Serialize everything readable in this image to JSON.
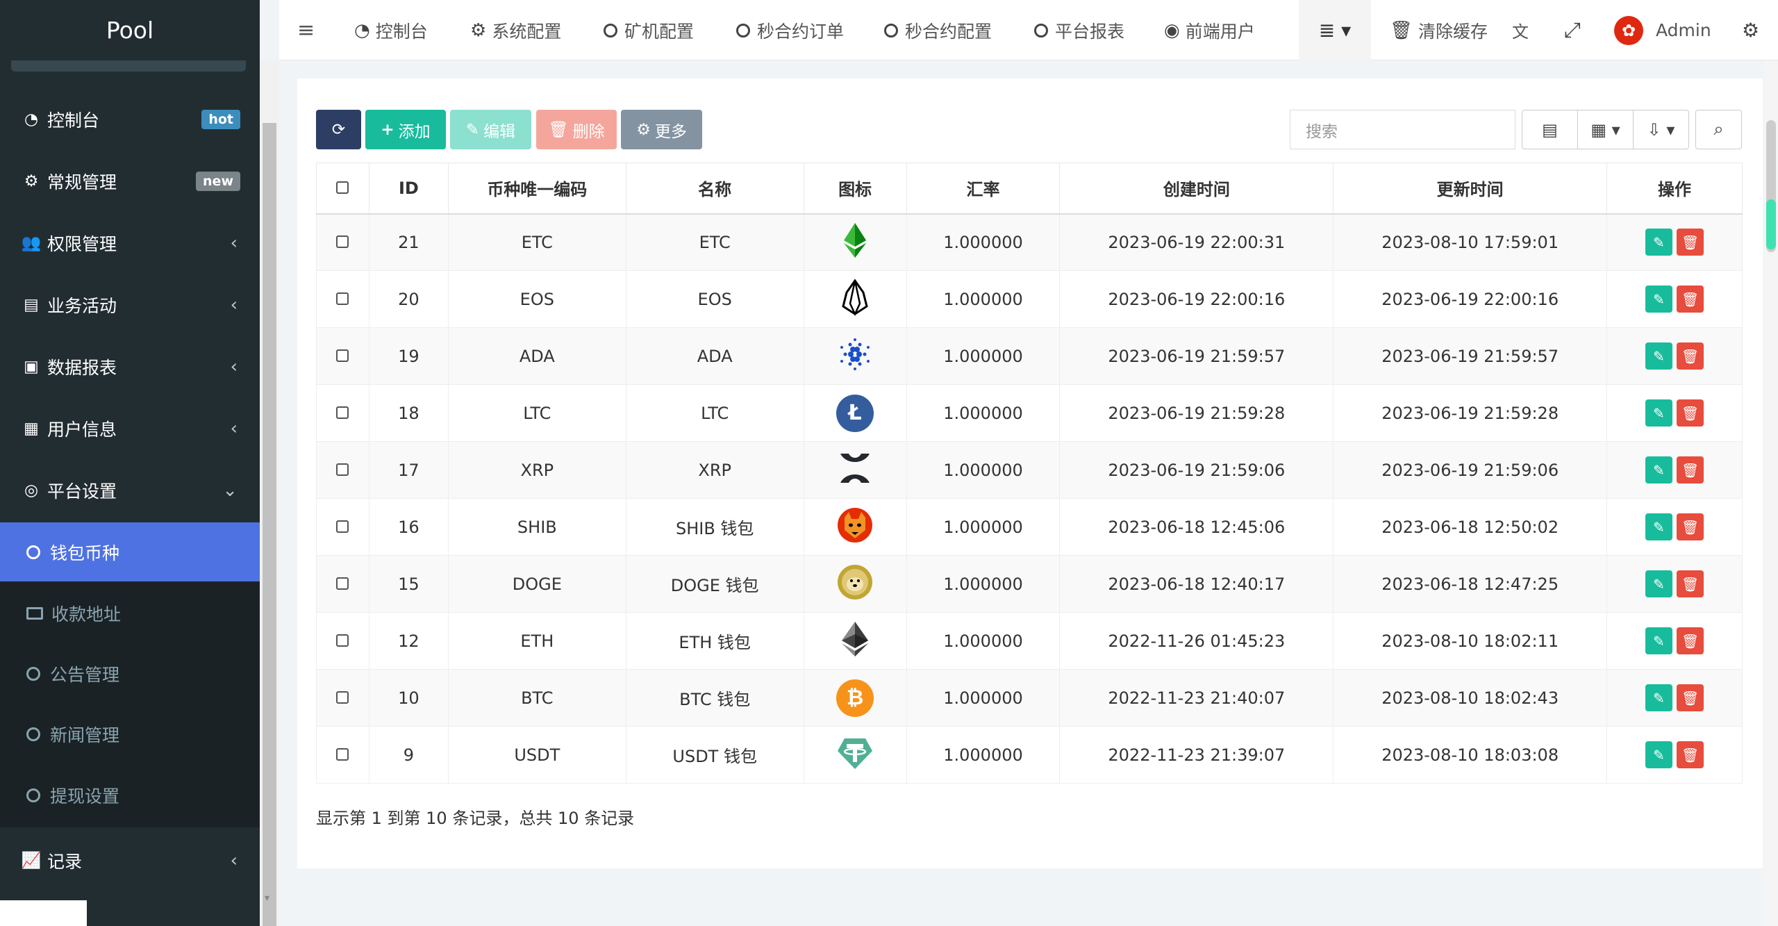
{
  "app": {
    "brand": "Pool"
  },
  "sidebar": {
    "items": [
      {
        "label": "控制台",
        "icon": "dashboard-icon",
        "glyph": "◔",
        "badge": "hot"
      },
      {
        "label": "常规管理",
        "icon": "cogs-icon",
        "glyph": "⚙",
        "badge": "new"
      },
      {
        "label": "权限管理",
        "icon": "users-icon",
        "glyph": "👥",
        "arrow": "‹"
      },
      {
        "label": "业务活动",
        "icon": "newspaper-icon",
        "glyph": "▤",
        "arrow": "‹"
      },
      {
        "label": "数据报表",
        "icon": "file-text-icon",
        "glyph": "▣",
        "arrow": "‹"
      },
      {
        "label": "用户信息",
        "icon": "user-card-icon",
        "glyph": "▦",
        "arrow": "‹"
      },
      {
        "label": "平台设置",
        "icon": "target-icon",
        "glyph": "◎",
        "arrow": "⌄"
      }
    ],
    "submenu": [
      {
        "label": "钱包币种",
        "active": true,
        "icon": "circle-icon"
      },
      {
        "label": "收款地址",
        "icon": "address-card-icon"
      },
      {
        "label": "公告管理",
        "icon": "circle-icon"
      },
      {
        "label": "新闻管理",
        "icon": "circle-icon"
      },
      {
        "label": "提现设置",
        "icon": "circle-icon"
      }
    ],
    "bottom_item": {
      "label": "记录",
      "icon": "area-chart-icon",
      "glyph": "📈",
      "arrow": "‹"
    }
  },
  "topnav": {
    "menu_toggle": "≡",
    "items": [
      {
        "label": "控制台",
        "icon": "dashboard-icon",
        "glyph": "◔"
      },
      {
        "label": "系统配置",
        "icon": "cog-icon",
        "glyph": "⚙"
      },
      {
        "label": "矿机配置",
        "icon": "circle-icon"
      },
      {
        "label": "秒合约订单",
        "icon": "circle-icon"
      },
      {
        "label": "秒合约配置",
        "icon": "circle-icon"
      },
      {
        "label": "平台报表",
        "icon": "circle-icon"
      },
      {
        "label": "前端用户",
        "icon": "user-circle-icon",
        "glyph": "◉"
      }
    ],
    "list_menu": "≣ ▾",
    "clear_cache": "清除缓存",
    "translate_glyph": "文",
    "fullscreen_glyph": "⤢",
    "user": "Admin",
    "settings_glyph": "⚙"
  },
  "toolbar": {
    "refresh": "⟳",
    "add": "添加",
    "edit": "编辑",
    "delete": "删除",
    "more": "更多",
    "search_placeholder": "搜索",
    "view_list": "▤",
    "view_columns": "▦ ▾",
    "export": "⇩ ▾",
    "search_glyph": "⌕"
  },
  "table": {
    "columns": [
      "ID",
      "币种唯一编码",
      "名称",
      "图标",
      "汇率",
      "创建时间",
      "更新时间",
      "操作"
    ],
    "rows": [
      {
        "id": "21",
        "code": "ETC",
        "name": "ETC",
        "icon": "etc-icon",
        "rate": "1.000000",
        "created": "2023-06-19 22:00:31",
        "updated": "2023-08-10 17:59:01"
      },
      {
        "id": "20",
        "code": "EOS",
        "name": "EOS",
        "icon": "eos-icon",
        "rate": "1.000000",
        "created": "2023-06-19 22:00:16",
        "updated": "2023-06-19 22:00:16"
      },
      {
        "id": "19",
        "code": "ADA",
        "name": "ADA",
        "icon": "ada-icon",
        "rate": "1.000000",
        "created": "2023-06-19 21:59:57",
        "updated": "2023-06-19 21:59:57"
      },
      {
        "id": "18",
        "code": "LTC",
        "name": "LTC",
        "icon": "ltc-icon",
        "rate": "1.000000",
        "created": "2023-06-19 21:59:28",
        "updated": "2023-06-19 21:59:28"
      },
      {
        "id": "17",
        "code": "XRP",
        "name": "XRP",
        "icon": "xrp-icon",
        "rate": "1.000000",
        "created": "2023-06-19 21:59:06",
        "updated": "2023-06-19 21:59:06"
      },
      {
        "id": "16",
        "code": "SHIB",
        "name": "SHIB 钱包",
        "icon": "shib-icon",
        "rate": "1.000000",
        "created": "2023-06-18 12:45:06",
        "updated": "2023-06-18 12:50:02"
      },
      {
        "id": "15",
        "code": "DOGE",
        "name": "DOGE 钱包",
        "icon": "doge-icon",
        "rate": "1.000000",
        "created": "2023-06-18 12:40:17",
        "updated": "2023-06-18 12:47:25"
      },
      {
        "id": "12",
        "code": "ETH",
        "name": "ETH 钱包",
        "icon": "eth-icon",
        "rate": "1.000000",
        "created": "2022-11-26 01:45:23",
        "updated": "2023-08-10 18:02:11"
      },
      {
        "id": "10",
        "code": "BTC",
        "name": "BTC 钱包",
        "icon": "btc-icon",
        "rate": "1.000000",
        "created": "2022-11-23 21:40:07",
        "updated": "2023-08-10 18:02:43"
      },
      {
        "id": "9",
        "code": "USDT",
        "name": "USDT 钱包",
        "icon": "usdt-icon",
        "rate": "1.000000",
        "created": "2022-11-23 21:39:07",
        "updated": "2023-08-10 18:03:08"
      }
    ]
  },
  "pagination": {
    "summary": "显示第 1 到第 10 条记录，总共 10 条记录"
  },
  "colors": {
    "sidebar_bg": "#222d32",
    "active_item": "#4f72e2",
    "success": "#18bc9c",
    "danger": "#e74c3c",
    "primary_dark": "#2c3e63"
  }
}
